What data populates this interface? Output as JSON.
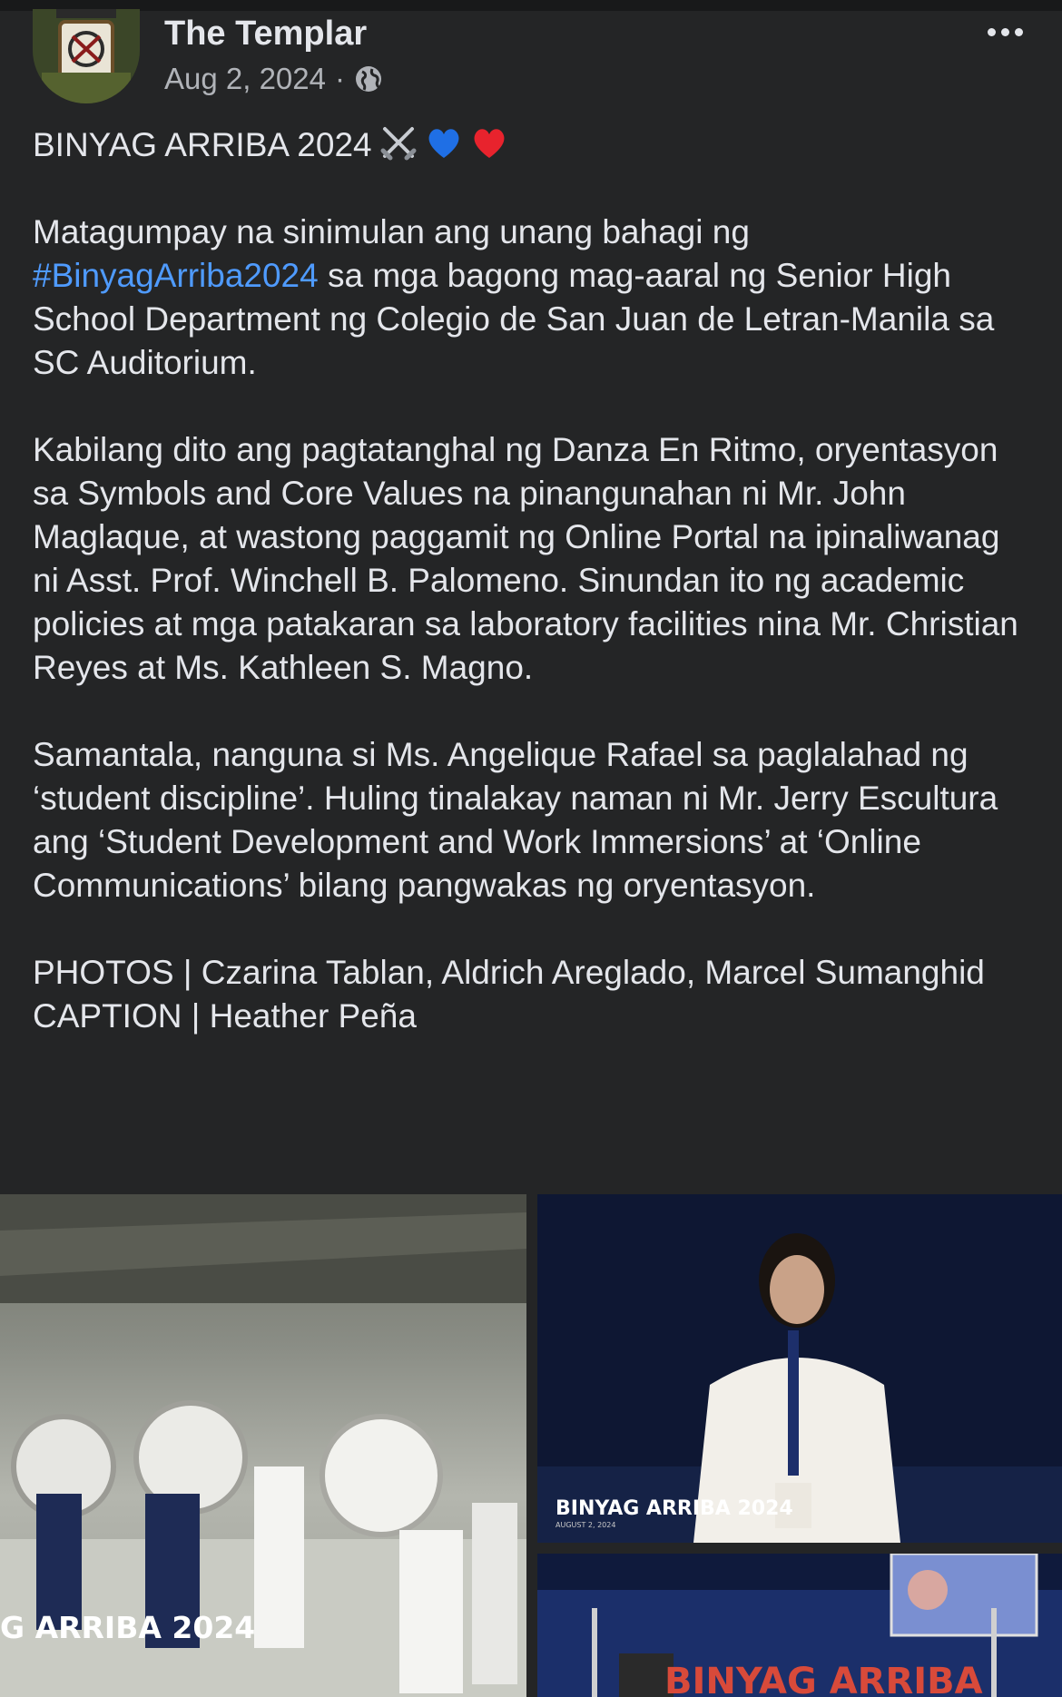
{
  "post": {
    "page_name": "The Templar",
    "date": "Aug 2, 2024",
    "separator": "·",
    "audience_icon": "globe-icon",
    "more_icon": "more-options-icon",
    "title": "BINYAG ARRIBA 2024",
    "title_emojis": [
      "crossed-swords-icon",
      "blue-heart-icon",
      "red-heart-icon"
    ],
    "para1_before": "Matagumpay na sinimulan ang unang bahagi ng\n",
    "hashtag": "#BinyagArriba2024",
    "para1_after": " sa mga bagong mag-aaral ng Senior High School Department ng Colegio de San Juan de Letran-Manila sa SC Auditorium.",
    "para2": "Kabilang dito ang pagtatanghal ng Danza En Ritmo, oryentasyon sa Symbols and Core Values na pinangunahan ni Mr. John Maglaque, at wastong paggamit ng Online Portal na ipinaliwanag ni Asst. Prof. Winchell B. Palomeno. Sinundan ito ng academic policies at mga patakaran sa laboratory facilities nina Mr. Christian Reyes at Ms. Kathleen S. Magno.",
    "para3": "Samantala, nanguna si Ms. Angelique Rafael sa paglalahad ng ‘student discipline’. Huling tinalakay naman ni Mr. Jerry Escultura ang ‘Student Development and Work Immersions’ at ‘Online Communications’ bilang pangwakas ng oryentasyon.",
    "credits_photos": "PHOTOS | Czarina Tablan, Aldrich Areglado, Marcel Sumanghid",
    "credits_caption": "CAPTION | Heather Peña"
  },
  "photos": [
    {
      "caption": "G ARRIBA 2024"
    },
    {
      "caption": "BINYAG ARRIBA 2024",
      "subcaption": "AUGUST 2, 2024"
    },
    {
      "caption": "BINYAG ARRIBA"
    }
  ],
  "colors": {
    "background": "#242526",
    "text": "#e4e6eb",
    "secondary_text": "#b0b3b8",
    "link": "#4f9bff"
  }
}
